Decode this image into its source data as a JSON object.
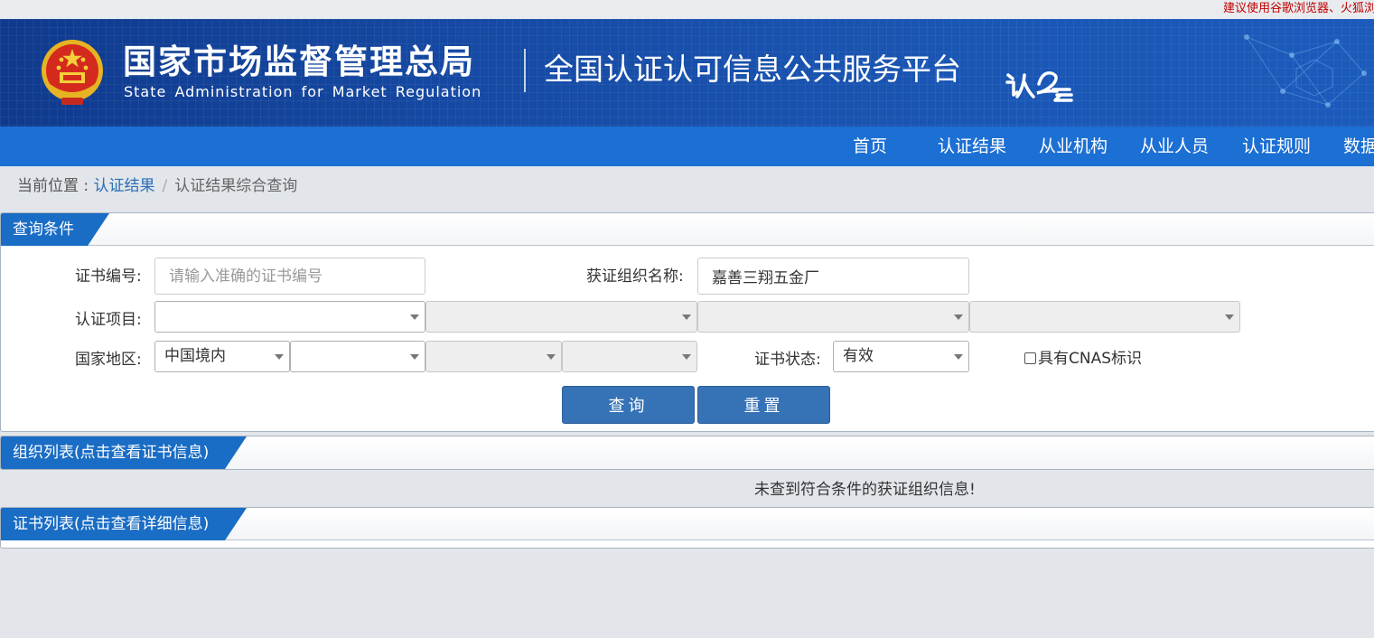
{
  "topbar": {
    "notice": "建议使用谷歌浏览器、火狐浏览器"
  },
  "header": {
    "org_name_cn": "国家市场监督管理总局",
    "org_name_en": "State Administration  for  Market Regulation",
    "platform_title": "全国认证认可信息公共服务平台",
    "emblem_icon": "national-emblem-icon",
    "logo_icon": "renzheng-cloud-logo-icon",
    "brand_color": "#1a56b4"
  },
  "nav": {
    "items": [
      {
        "label": "首页"
      },
      {
        "label": "认证结果"
      },
      {
        "label": "从业机构"
      },
      {
        "label": "从业人员"
      },
      {
        "label": "认证规则"
      },
      {
        "label": "数据"
      }
    ]
  },
  "breadcrumb": {
    "prefix": "当前位置 : ",
    "link": "认证结果",
    "separator": "/",
    "current": "认证结果综合查询"
  },
  "query": {
    "title": "查询条件",
    "cert_no_label": "证书编号:",
    "cert_no_placeholder": "请输入准确的证书编号",
    "cert_no_value": "",
    "org_name_label": "获证组织名称:",
    "org_name_value": "嘉善三翔五金厂",
    "cert_project_label": "认证项目:",
    "cert_project_values": [
      "",
      "",
      "",
      ""
    ],
    "region_label": "国家地区:",
    "region_values": [
      "中国境内",
      "",
      "",
      ""
    ],
    "status_label": "证书状态:",
    "status_value": "有效",
    "cnas_label": "具有CNAS标识",
    "search_button": "查询",
    "reset_button": "重置"
  },
  "org_list": {
    "title": "组织列表(点击查看证书信息)",
    "empty_message": "未查到符合条件的获证组织信息!"
  },
  "cert_list": {
    "title": "证书列表(点击查看详细信息)"
  }
}
